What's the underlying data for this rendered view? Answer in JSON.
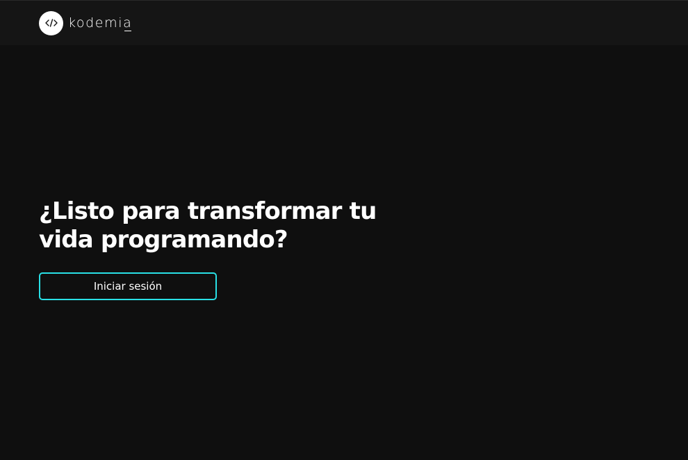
{
  "brand": {
    "name": "kodemia",
    "logo_icon": "code-brackets-icon"
  },
  "hero": {
    "title": "¿Listo para transformar tu vida programando?"
  },
  "actions": {
    "login_label": "Iniciar sesión"
  },
  "colors": {
    "background": "#0f0f0f",
    "navbar": "#151515",
    "accent": "#29e0e6",
    "text": "#ffffff"
  }
}
